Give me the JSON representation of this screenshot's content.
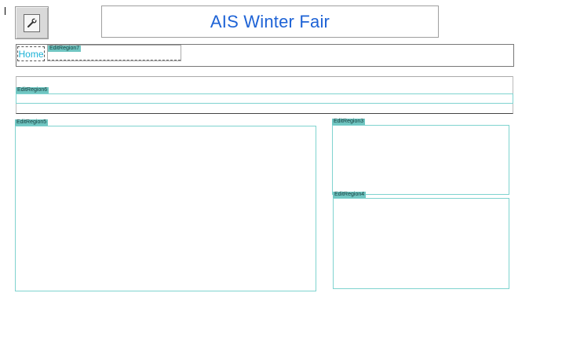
{
  "header": {
    "title": "AIS Winter Fair",
    "logo_icon": "wrench-icon"
  },
  "nav": {
    "home_label": "Home"
  },
  "regions": {
    "region7": "EditRegion7",
    "region6": "EditRegion6",
    "region5": "EditRegion5",
    "region3": "EditRegion3",
    "region4": "EditRegion4"
  },
  "colors": {
    "title": "#1e63d6",
    "home_link": "#1bb2d6",
    "region_tag": "#70c6c2",
    "region_border": "#7fd3cf"
  }
}
